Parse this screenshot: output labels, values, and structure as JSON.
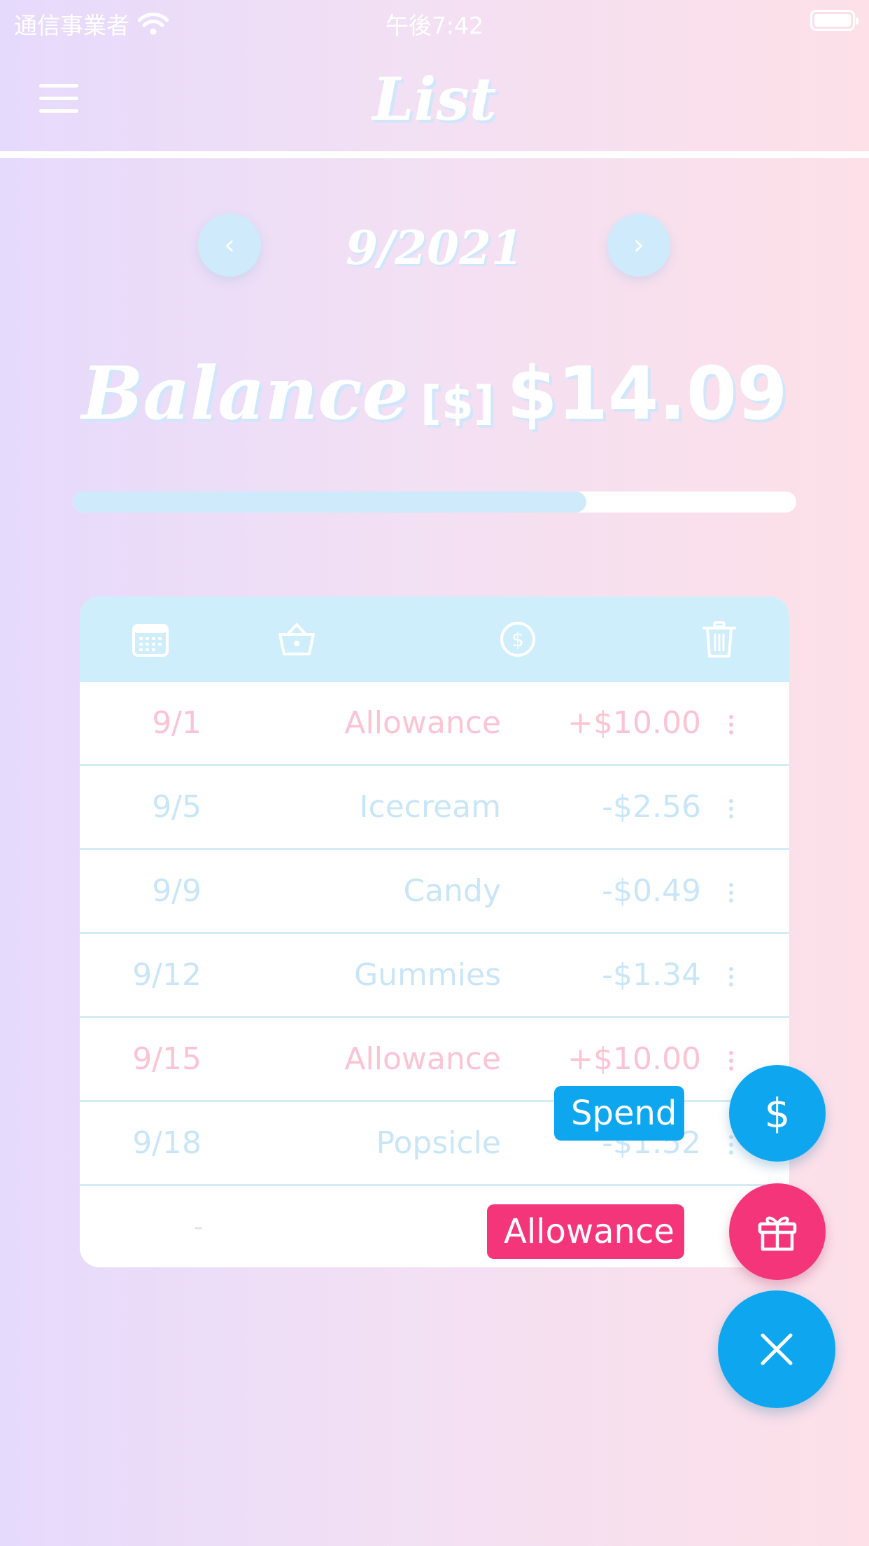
{
  "status_bar": {
    "carrier": "通信事業者",
    "time": "午後7:42"
  },
  "header": {
    "title": "List"
  },
  "month_nav": {
    "prev": "‹",
    "month": "9/2021",
    "next": "›"
  },
  "balance": {
    "label": "Balance",
    "currency": "[$]",
    "amount": "$14.09",
    "progress": 0.71
  },
  "table": {
    "header_icons": [
      "calendar-icon",
      "basket-icon",
      "dollar-circle-icon",
      "trash-icon"
    ],
    "rows": [
      {
        "date": "9/1",
        "name": "Allowance",
        "amount": "+$10.00",
        "type": "income"
      },
      {
        "date": "9/5",
        "name": "Icecream",
        "amount": "-$2.56",
        "type": "expense"
      },
      {
        "date": "9/9",
        "name": "Candy",
        "amount": "-$0.49",
        "type": "expense"
      },
      {
        "date": "9/12",
        "name": "Gummies",
        "amount": "-$1.34",
        "type": "expense"
      },
      {
        "date": "9/15",
        "name": "Allowance",
        "amount": "+$10.00",
        "type": "income"
      },
      {
        "date": "9/18",
        "name": "Popsicle",
        "amount": "-$1.52",
        "type": "expense"
      },
      {
        "date": "-",
        "name": "-",
        "amount": "",
        "type": "empty"
      }
    ]
  },
  "fab": {
    "spend_label": "Spend",
    "spend_symbol": "$",
    "allowance_label": "Allowance",
    "colors": {
      "blue": "#0ea7ef",
      "pink": "#f4357a"
    }
  }
}
